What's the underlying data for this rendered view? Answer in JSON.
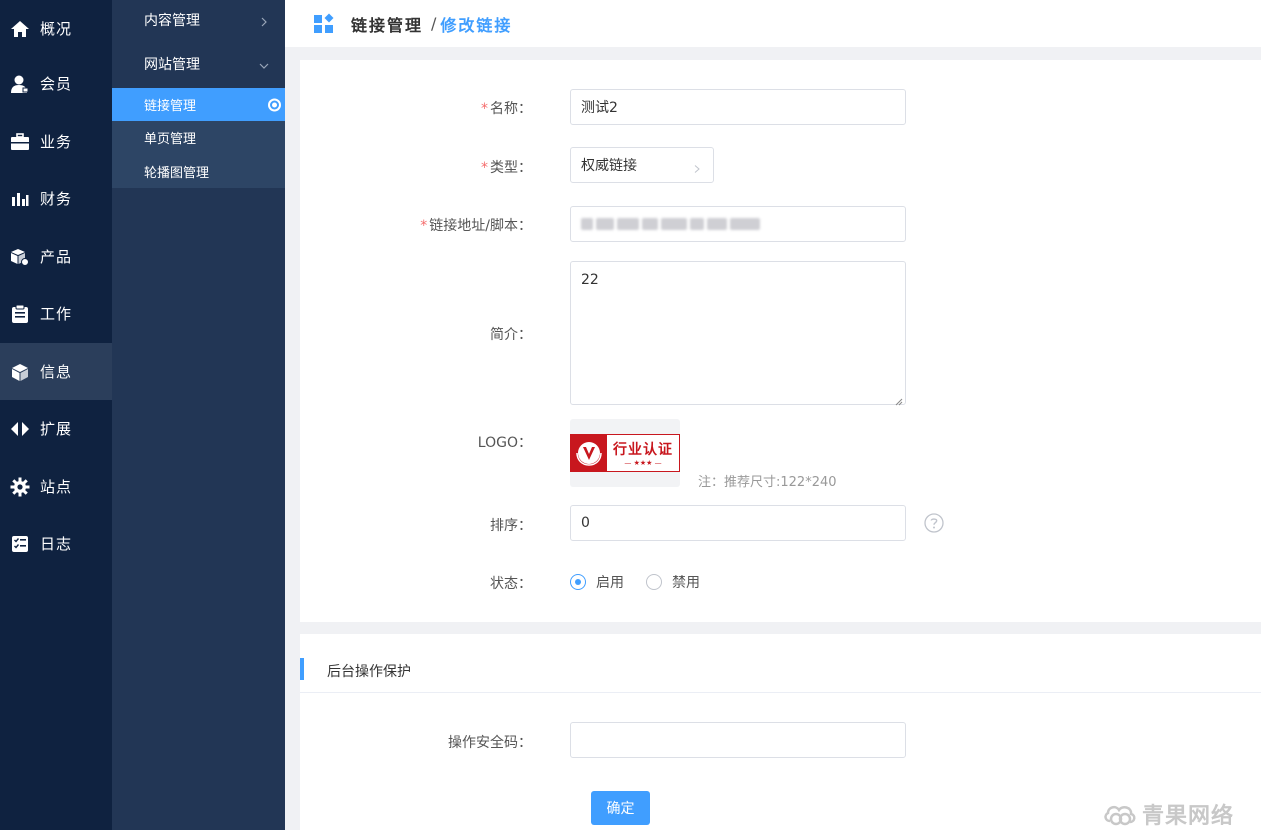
{
  "primary_nav": [
    {
      "label": "概况",
      "icon": "home-icon"
    },
    {
      "label": "会员",
      "icon": "user-icon"
    },
    {
      "label": "业务",
      "icon": "briefcase-icon"
    },
    {
      "label": "财务",
      "icon": "bar-chart-icon"
    },
    {
      "label": "产品",
      "icon": "cube-icon"
    },
    {
      "label": "工作",
      "icon": "clipboard-icon"
    },
    {
      "label": "信息",
      "icon": "box-icon",
      "active": true
    },
    {
      "label": "扩展",
      "icon": "expand-arrows-icon"
    },
    {
      "label": "站点",
      "icon": "gear-icon"
    },
    {
      "label": "日志",
      "icon": "checklist-icon"
    }
  ],
  "secondary_nav": {
    "groups": [
      {
        "label": "内容管理",
        "expanded": false
      },
      {
        "label": "网站管理",
        "expanded": true
      }
    ],
    "sub_items": [
      {
        "label": "链接管理",
        "active": true
      },
      {
        "label": "单页管理"
      },
      {
        "label": "轮播图管理"
      }
    ]
  },
  "header": {
    "icon": "widgets-icon",
    "crumb_parent": "链接管理",
    "separator": "/",
    "crumb_current": "修改链接"
  },
  "form": {
    "required_mark": "*",
    "name_label": "名称：",
    "name_value": "测试2",
    "type_label": "类型：",
    "type_value": "权威链接",
    "url_label": "链接地址/脚本：",
    "intro_label": "简介：",
    "intro_value": "22",
    "logo_label": "LOGO：",
    "logo_image_text": "行业认证",
    "logo_image_stars": "— ★★★ —",
    "logo_hint": "注：推荐尺寸:122*240",
    "sort_label": "排序：",
    "sort_value": "0",
    "status_label": "状态：",
    "status_options": [
      "启用",
      "禁用"
    ],
    "status_selected": "启用"
  },
  "protection": {
    "title": "后台操作保护",
    "code_label": "操作安全码：",
    "code_value": "",
    "submit_label": "确定"
  },
  "watermark": "青果网络",
  "colors": {
    "primary": "#409eff",
    "sidebar_dark": "#0f2240",
    "sidebar_secondary": "#223655",
    "required": "#f56c6c"
  }
}
